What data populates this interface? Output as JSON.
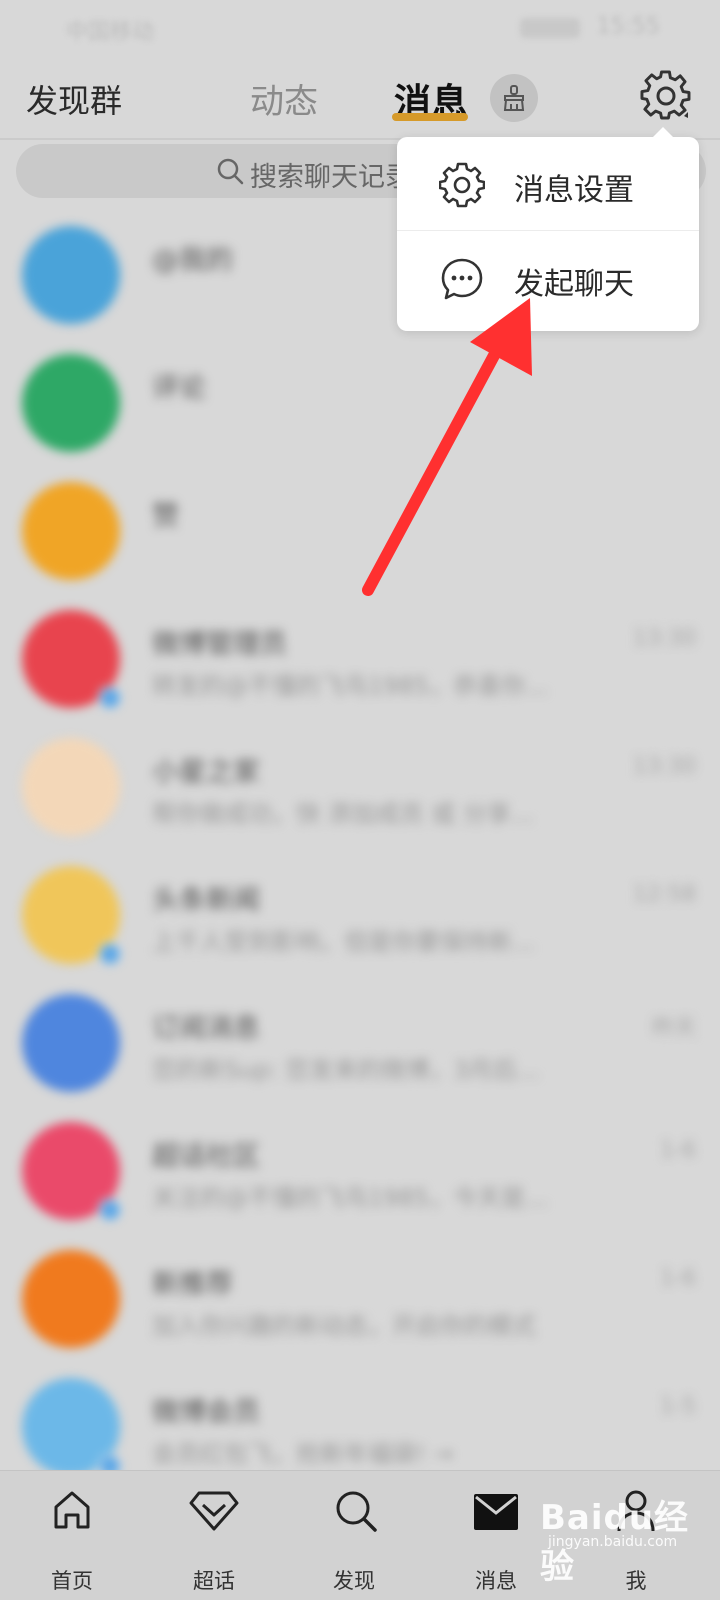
{
  "status_bar": {
    "carrier": "中国移动",
    "time": "15:55"
  },
  "header": {
    "discover_groups": "发现群",
    "tab_dynamic": "动态",
    "tab_messages": "消息",
    "accent_color": "#d69a2a",
    "brush_icon": "brush-icon",
    "settings_icon": "gear-icon"
  },
  "search": {
    "placeholder": "搜索聊天记录"
  },
  "popup_menu": {
    "items": [
      {
        "label": "消息设置",
        "icon": "gear-icon"
      },
      {
        "label": "发起聊天",
        "icon": "chat-bubble-icon"
      }
    ]
  },
  "conversations": [
    {
      "name": "@我的",
      "preview": "",
      "time": "",
      "avatar_color": "#4aa3d9"
    },
    {
      "name": "评论",
      "preview": "",
      "time": "",
      "avatar_color": "#2ea866"
    },
    {
      "name": "赞",
      "preview": "",
      "time": "",
      "avatar_color": "#f0a526"
    },
    {
      "name": "微博管理员",
      "preview": "转发的@不懂的飞鸟1985，恭喜你...",
      "time": "13:30",
      "avatar_color": "#e8444e"
    },
    {
      "name": "小星之家",
      "preview": "帮你做成功，快 添加成员 或 分享...",
      "time": "13:30",
      "avatar_color": "#f3d7b8"
    },
    {
      "name": "头条新闻",
      "preview": "上千人受到影响，但是你要保持新...",
      "time": "12:58",
      "avatar_color": "#f0c65a"
    },
    {
      "name": "订阅消息",
      "preview": "您的新Sup: 您发来的微博，3月后...",
      "time": "昨天",
      "avatar_color": "#4f86de"
    },
    {
      "name": "超话社区",
      "preview": "关注的@不懂的飞鸟1985，今天是...",
      "time": "1-6",
      "avatar_color": "#ea4a6a"
    },
    {
      "name": "新推荐",
      "preview": "加入你兴趣的新动态，开启你的模式",
      "time": "1-6",
      "avatar_color": "#f07a1e"
    },
    {
      "name": "微博会员",
      "preview": "会员红包飞，抢新年福袋! →",
      "time": "1-5",
      "avatar_color": "#6cb8e8"
    }
  ],
  "bottom_nav": [
    {
      "label": "首页",
      "icon": "home-icon"
    },
    {
      "label": "超话",
      "icon": "diamond-icon"
    },
    {
      "label": "发现",
      "icon": "search-icon"
    },
    {
      "label": "消息",
      "icon": "mail-icon"
    },
    {
      "label": "我",
      "icon": "user-icon"
    }
  ],
  "watermark": {
    "text": "Baidu经验",
    "sub": "jingyan.baidu.com"
  }
}
